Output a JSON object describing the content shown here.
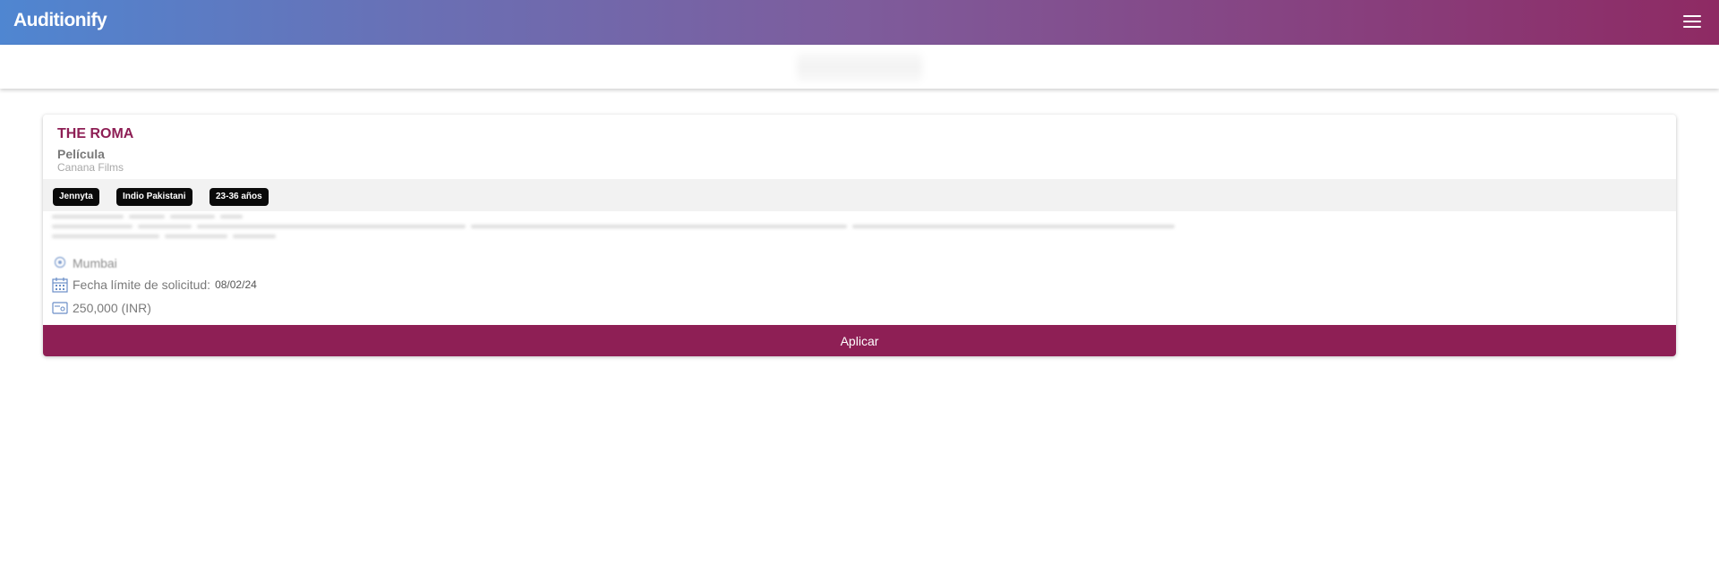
{
  "header": {
    "logo_text": "Auditionify",
    "menu_icon": "hamburger-menu-icon",
    "gradient_start": "#4f86d1",
    "gradient_end": "#8e2a63"
  },
  "listing": {
    "title": "THE ROMA",
    "category": "Película",
    "company": "Canana Films",
    "tags": [
      "Jennyta",
      "Indio Pakistani",
      "23-36 años"
    ],
    "location": "Mumbai",
    "deadline_label": "Fecha límite de solicitud:",
    "deadline_value": "08/02/24",
    "compensation": "250,000 (INR)",
    "apply_label": "Aplicar",
    "accent_color": "#8e1f55"
  }
}
